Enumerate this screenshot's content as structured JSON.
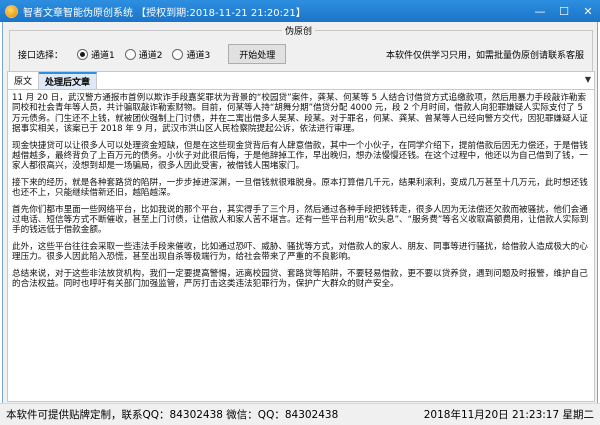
{
  "window": {
    "title": "智者文章智能伪原创系统 【授权到期:2018-11-21 21:20:21】",
    "min_glyph": "—",
    "max_glyph": "☐",
    "close_glyph": "✕"
  },
  "options": {
    "group_title": "伪原创",
    "interface_label": "接口选择：",
    "channels": [
      "通道1",
      "通道2",
      "通道3"
    ],
    "selected_channel": "通道1",
    "start_button": "开始处理",
    "notice": "本软件仅供学习只用，如需批量伪原创请联系客服"
  },
  "tabs": [
    {
      "label": "原文",
      "active": false
    },
    {
      "label": "处理后文章",
      "active": true
    }
  ],
  "article": {
    "paragraphs": [
      "11 月 20 日，武汉警方通报市首例以欺诈手段嘉奖罪状为背景的“校园贷”案件，龚某、何某等 5 人结合讨借贷方式追缴款项，然后用暴力手段敲诈勒索同校和社会青年等人员，共计骗取敲诈勒索财物。目前，何某等人持“胡舞分期”借贷分配 4000 元，段 2 个月时间，借款人向犯罪嫌疑人实际支付了 5 万元债务。门生还不上钱，就被团伙强制上门讨债，并在二寓出借多人吴某、段某。对于罪名，何某、龚某、曾某等人已经向警方交代，因犯罪嫌疑人证据事实相关，该案已于 2018 年 9 月，武汉市洪山区人民检察院提起公诉，依法进行审理。",
      "现金快捷贷可以让很多人可以处理资金短缺，但是在这些现金贷背后有人肆意借款，其中一个小伙子，在同学介绍下，提前借款后因无力偿还，于是借钱越借越多，最终背负了上百万元的债务。小伙子对此很后悔，于是他辞掉工作，早出晚归，想办法慢慢还钱。在这个过程中，他还以为自己借到了钱，一家人都很高兴，没想到却是一场骗局，很多人因此受害，被借钱人围堵家门。",
      "接下来的经历，就是各种套路贷的陷阱，一步步掉进深渊，一旦借钱就很难脱身。原本打算借几千元，结果利滚利，变成几万甚至十几万元，此时想还钱也还不上，只能继续借新还旧，越陷越深。",
      "首先你们都市里面一些网络平台，比如我说的那个平台，其实得手了三个月，然后通过各种手段把钱转走，很多人因为无法偿还欠款而被骚扰，他们会通过电话、短信等方式不断催收，甚至上门讨债，让借款人和家人苦不堪言。还有一些平台利用“砍头息”、“服务费”等名义收取高额费用，让借款人实际到手的钱远低于借款金额。",
      "此外，这些平台往往会采取一些违法手段来催收，比如通过恐吓、威胁、骚扰等方式，对借款人的家人、朋友、同事等进行骚扰，给借款人造成极大的心理压力。很多人因此陷入恐慌，甚至出现自杀等极端行为，给社会带来了严重的不良影响。",
      "总结来说，对于这些非法放贷机构，我们一定要提高警惕，远离校园贷、套路贷等陷阱，不要轻易借款，更不要以贷养贷，遇到问题及时报警，维护自己的合法权益。同时也呼吁有关部门加强监管，严厉打击这类违法犯罪行为，保护广大群众的财产安全。"
    ]
  },
  "statusbar": {
    "left": "本软件可提供贴牌定制，联系QQ：84302438 微信：QQ：84302438",
    "right": "2018年11月20日 21:23:17 星期二"
  },
  "colors": {
    "titlebar": "#1b74c8",
    "active_tab": "#dde9f6",
    "background": "#f0f0f0"
  }
}
